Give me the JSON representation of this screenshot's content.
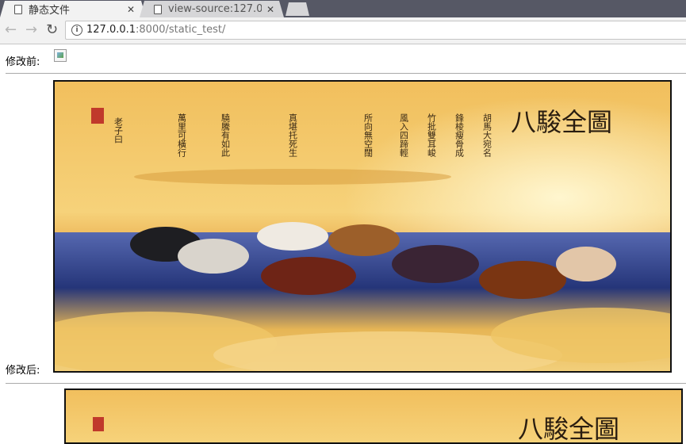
{
  "tabs": [
    {
      "title": "静态文件",
      "active": true
    },
    {
      "title": "view-source:127.0.0",
      "active": false
    }
  ],
  "toolbar": {
    "url_host": "127.0.0.1",
    "url_rest": ":8000/static_test/"
  },
  "content": {
    "before_label": "修改前:",
    "after_label": "修改后:"
  },
  "painting": {
    "title": "八駿全圖",
    "calligraphy_columns": [
      "胡馬大宛名",
      "鋒棱瘦骨成",
      "竹批雙耳峻",
      "風入四蹄輕",
      "所向無空闊",
      "真堪托死生",
      "驍騰有如此",
      "萬里可橫行"
    ],
    "colors": {
      "sky_top": "#f4c96a",
      "sky_glow": "#ffe9a6",
      "cloud_blue": "#2b3f8e",
      "cloud_gold": "#e9b54f"
    }
  }
}
